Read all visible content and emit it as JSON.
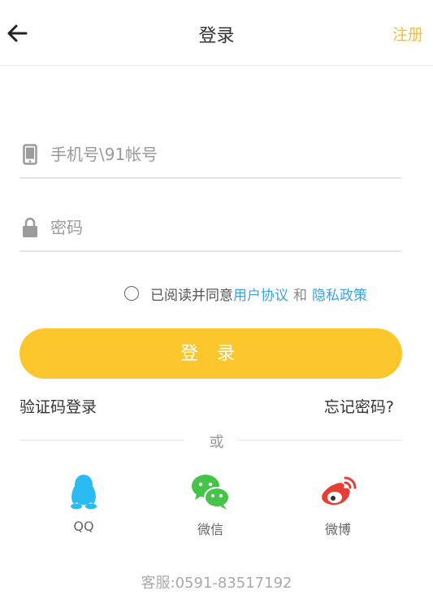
{
  "header": {
    "title": "登录",
    "register_label": "注册"
  },
  "form": {
    "account_placeholder": "手机号\\91帐号",
    "password_placeholder": "密码"
  },
  "agreement": {
    "prefix": "已阅读并同意",
    "user_agreement": "用户协议",
    "and": "和",
    "privacy_policy": "隐私政策"
  },
  "login_button": "登 录",
  "links": {
    "sms_login": "验证码登录",
    "forgot_password": "忘记密码?"
  },
  "or_label": "或",
  "social": [
    {
      "label": "QQ",
      "icon": "qq-icon",
      "color": "#2bbbf3"
    },
    {
      "label": "微信",
      "icon": "wechat-icon",
      "color": "#45c448"
    },
    {
      "label": "微博",
      "icon": "weibo-icon",
      "color": "#e53f33"
    }
  ],
  "service_phone": "客服:0591-83517192",
  "colors": {
    "accent": "#fcc72c",
    "register": "#fbbf22",
    "link": "#3aa3e0"
  }
}
